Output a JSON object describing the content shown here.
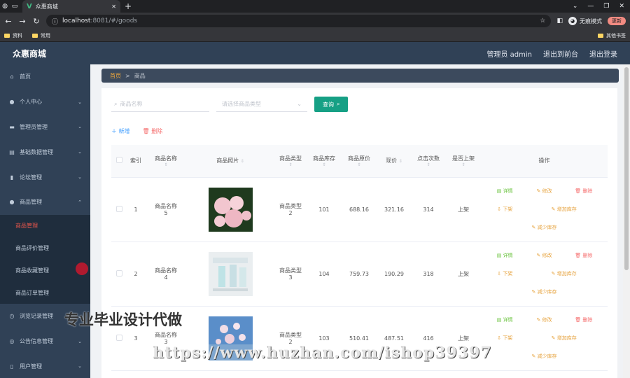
{
  "browser": {
    "tab_title": "众惠商城",
    "url_host": "localhost",
    "url_path": ":8081/#/goods",
    "incognito_label": "无痕模式",
    "update_label": "更新",
    "bookmarks": [
      "资料",
      "常用"
    ],
    "other_bookmarks": "其他书签"
  },
  "header": {
    "title": "众惠商城",
    "user": "管理员 admin",
    "to_front": "退出到前台",
    "logout": "退出登录"
  },
  "sidebar": {
    "items": [
      {
        "label": "首页",
        "icon": "home-icon",
        "glyph": "⌂",
        "arrow": ""
      },
      {
        "label": "个人中心",
        "icon": "user-icon",
        "glyph": "●",
        "arrow": "⌄"
      },
      {
        "label": "管理员管理",
        "icon": "chat-icon",
        "glyph": "▬",
        "arrow": "⌄"
      },
      {
        "label": "基础数据管理",
        "icon": "doc-icon",
        "glyph": "▤",
        "arrow": "⌄"
      },
      {
        "label": "论坛管理",
        "icon": "chart-icon",
        "glyph": "▮",
        "arrow": "⌄"
      },
      {
        "label": "商品管理",
        "icon": "user-icon",
        "glyph": "●",
        "arrow": "⌃"
      }
    ],
    "subitems": [
      "商品管理",
      "商品评价管理",
      "商品收藏管理",
      "商品订单管理"
    ],
    "items_after": [
      {
        "label": "浏览记录管理",
        "icon": "clock-icon",
        "glyph": "◷",
        "arrow": "⌄"
      },
      {
        "label": "公告信息管理",
        "icon": "compass-icon",
        "glyph": "◎",
        "arrow": "⌄"
      },
      {
        "label": "用户管理",
        "icon": "phone-icon",
        "glyph": "▯",
        "arrow": "⌄"
      }
    ]
  },
  "breadcrumb": {
    "home": "首页",
    "separator": ">",
    "current": "商品"
  },
  "search": {
    "name_placeholder": "商品名称",
    "type_placeholder": "请选择商品类型",
    "query_label": "查询"
  },
  "actions": {
    "add": "新增",
    "delete": "删除"
  },
  "table": {
    "headers": [
      "索引",
      "商品名称",
      "商品照片",
      "商品类型",
      "商品库存",
      "商品原价",
      "现价",
      "点击次数",
      "是否上架",
      "操作"
    ],
    "ops": {
      "detail": "详情",
      "edit": "修改",
      "delete": "删除",
      "off_shelf": "下架",
      "add_stock": "增加库存",
      "reduce_stock": "减少库存"
    },
    "rows": [
      {
        "index": "1",
        "name": "商品名称\n5",
        "type": "商品类型\n2",
        "stock": "101",
        "orig": "688.16",
        "price": "321.16",
        "clicks": "314",
        "shelf": "上架",
        "photo": "pink-roses"
      },
      {
        "index": "2",
        "name": "商品名称\n4",
        "type": "商品类型\n3",
        "stock": "104",
        "orig": "759.73",
        "price": "190.29",
        "clicks": "318",
        "shelf": "上架",
        "photo": "light-product"
      },
      {
        "index": "3",
        "name": "商品名称\n3",
        "type": "商品类型\n2",
        "stock": "103",
        "orig": "510.41",
        "price": "487.51",
        "clicks": "416",
        "shelf": "上架",
        "photo": "blue-flowers"
      }
    ]
  },
  "watermark": {
    "cn": "专业毕业设计代做",
    "url": "https://www.huzhan.com/ishop39397"
  }
}
